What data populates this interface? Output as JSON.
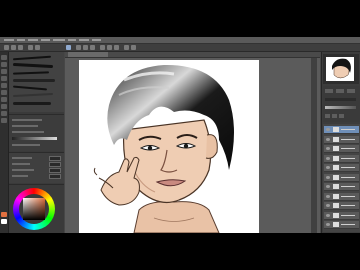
{
  "app": {
    "name": "illustration-paint-app",
    "document_tab": ""
  },
  "icons": {
    "menu": "menu-bar",
    "tools": [
      "pen-tool-icon",
      "brush-tool-icon",
      "eraser-tool-icon",
      "fill-tool-icon",
      "select-tool-icon",
      "move-tool-icon",
      "text-tool-icon",
      "hand-tool-icon",
      "zoom-tool-icon",
      "eyedropper-tool-icon"
    ],
    "layer_eye": "eye-icon"
  },
  "colors": {
    "ui_background": "#474747",
    "canvas_paper": "#ffffff",
    "selected_layer": "#6f8fb8",
    "current_color": "#e07040"
  },
  "layers": {
    "count": 11,
    "selected_index": 0
  }
}
